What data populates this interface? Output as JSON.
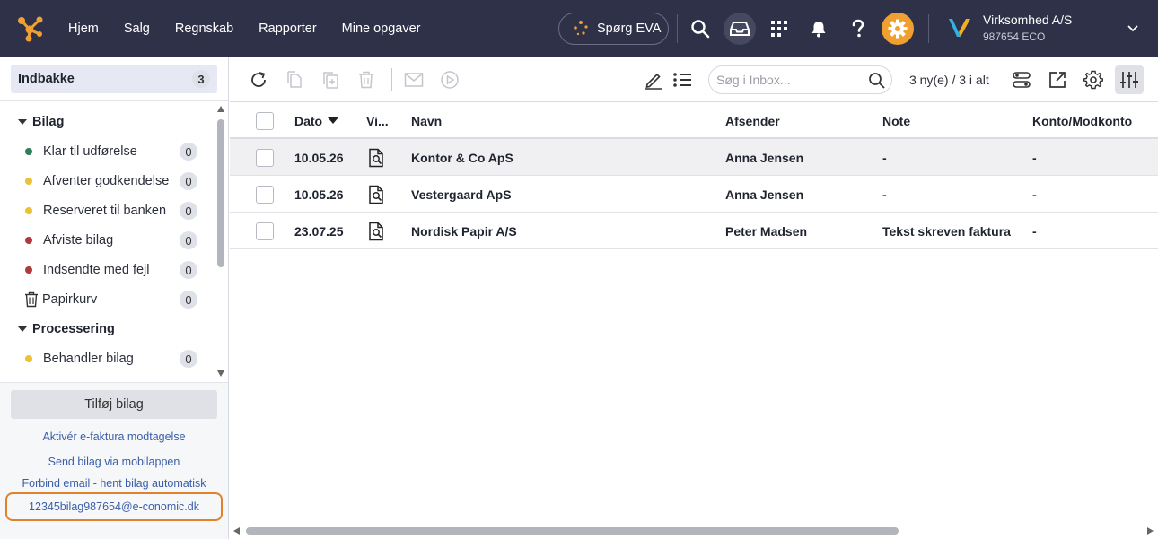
{
  "colors": {
    "topbar_bg": "#2f3148",
    "accent_orange": "#f0a030",
    "brand_logo": "#f0a030",
    "selection_outline": "#e0812c",
    "link": "#3a5ea8"
  },
  "nav": {
    "items": [
      {
        "label": "Hjem"
      },
      {
        "label": "Salg"
      },
      {
        "label": "Regnskab"
      },
      {
        "label": "Rapporter"
      },
      {
        "label": "Mine opgaver"
      }
    ],
    "eva_label": "Spørg EVA",
    "icons": [
      "search-icon",
      "inbox-icon",
      "apps-grid-icon",
      "bell-icon",
      "help-icon",
      "settings-gear-icon"
    ]
  },
  "company": {
    "name": "Virksomhed A/S",
    "id": "987654 ECO"
  },
  "sidebar": {
    "inbox": {
      "label": "Indbakke",
      "count": "3"
    },
    "groups": [
      {
        "label": "Bilag",
        "items": [
          {
            "label": "Klar til udførelse",
            "count": "0",
            "dot": "#2e7d5b"
          },
          {
            "label": "Afventer godkendelse",
            "count": "0",
            "dot": "#e8c23a"
          },
          {
            "label": "Reserveret til banken",
            "count": "0",
            "dot": "#e8c23a"
          },
          {
            "label": "Afviste bilag",
            "count": "0",
            "dot": "#b03a3a"
          },
          {
            "label": "Indsendte med fejl",
            "count": "0",
            "dot": "#b03a3a"
          },
          {
            "label": "Papirkurv",
            "count": "0",
            "icon": "trash-icon"
          }
        ]
      },
      {
        "label": "Processering",
        "items": [
          {
            "label": "Behandler bilag",
            "count": "0",
            "dot": "#e8c23a"
          }
        ]
      }
    ],
    "add_button": "Tilføj bilag",
    "links": {
      "efaktura": "Aktivér e-faktura modtagelse",
      "mobile": "Send bilag via mobilappen",
      "email": "Forbind email - hent bilag automatisk"
    },
    "email_address": "12345bilag987654@e-conomic.dk"
  },
  "toolbar": {
    "search_placeholder": "Søg i Inbox...",
    "status": "3 ny(e) / 3 i alt"
  },
  "table": {
    "headers": {
      "date": "Dato",
      "view": "Vi...",
      "name": "Navn",
      "sender": "Afsender",
      "note": "Note",
      "account": "Konto/Modkonto"
    },
    "rows": [
      {
        "date": "10.05.26",
        "name": "Kontor & Co ApS",
        "sender": "Anna Jensen",
        "note": "-",
        "account": "-"
      },
      {
        "date": "10.05.26",
        "name": "Vestergaard ApS",
        "sender": "Anna Jensen",
        "note": "-",
        "account": "-"
      },
      {
        "date": "23.07.25",
        "name": "Nordisk Papir A/S",
        "sender": "Peter Madsen",
        "note": "Tekst skreven faktura",
        "account": "-"
      }
    ]
  }
}
